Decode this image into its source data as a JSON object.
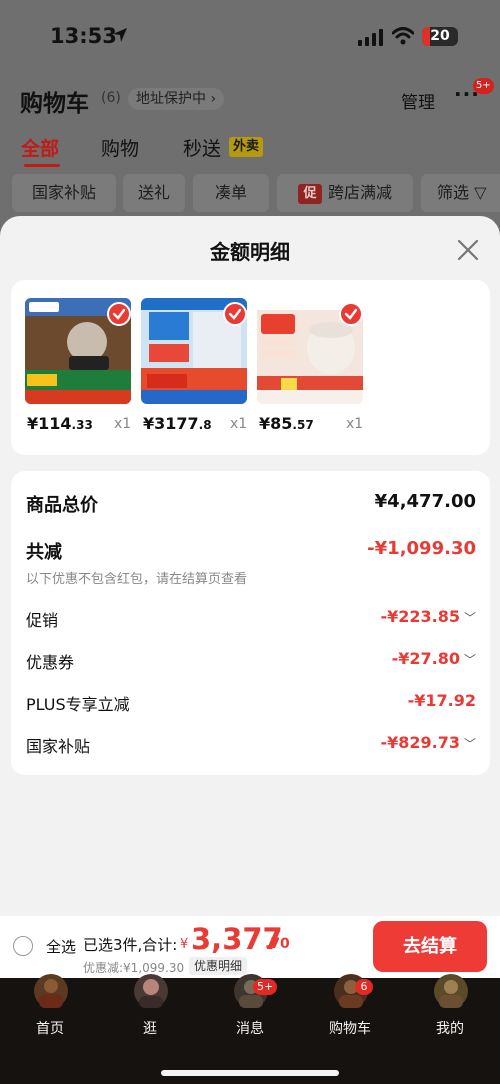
{
  "status_bar": {
    "time": "13:53",
    "battery": "20"
  },
  "header": {
    "title": "购物车",
    "count": "(6)",
    "address_protect": "地址保护中 ›",
    "manage": "管理",
    "more": "···",
    "more_badge": "5+"
  },
  "tabs": [
    {
      "label": "全部"
    },
    {
      "label": "购物"
    },
    {
      "label": "秒送"
    }
  ],
  "flash_tag": "外卖",
  "filters": {
    "subsidy": "国家补贴",
    "gift": "送礼",
    "bundle": "凑单",
    "promo_mark": "促",
    "store_discount": "跨店满减",
    "filter": "筛选 ▽"
  },
  "sheet": {
    "title": "金额明细",
    "products": [
      {
        "price_main": "¥114",
        "price_decimal": ".33",
        "qty": "x1"
      },
      {
        "price_main": "¥3177",
        "price_decimal": ".8",
        "qty": "x1"
      },
      {
        "price_main": "¥85",
        "price_decimal": ".57",
        "qty": "x1"
      }
    ],
    "summary": {
      "total_label": "商品总价",
      "total_value": "¥4,477.00",
      "reduce_label": "共减",
      "reduce_value": "-¥1,099.30",
      "reduce_note": "以下优惠不包含红包，请在结算页查看"
    },
    "discounts": [
      {
        "label": "促销",
        "value": "-¥223.85",
        "chevron": "﹀"
      },
      {
        "label": "优惠券",
        "value": "-¥27.80",
        "chevron": "﹀"
      },
      {
        "label": "PLUS专享立减",
        "value": "-¥17.92",
        "chevron": ""
      },
      {
        "label": "国家补贴",
        "value": "-¥829.73",
        "chevron": "﹀"
      }
    ]
  },
  "checkout": {
    "select_all": "全选",
    "selected_text": "已选3件,合计:",
    "currency": "¥",
    "amount": "3,377",
    "decimal": ".70",
    "discount_text": "优惠减:¥1,099.30",
    "detail_link": "优惠明细",
    "button": "去结算"
  },
  "nav": [
    {
      "label": "首页"
    },
    {
      "label": "逛"
    },
    {
      "label": "消息",
      "badge": "5+"
    },
    {
      "label": "购物车",
      "badge": "6"
    },
    {
      "label": "我的"
    }
  ],
  "colors": {
    "accent": "#e93a34",
    "tab_active": "#c41914"
  }
}
